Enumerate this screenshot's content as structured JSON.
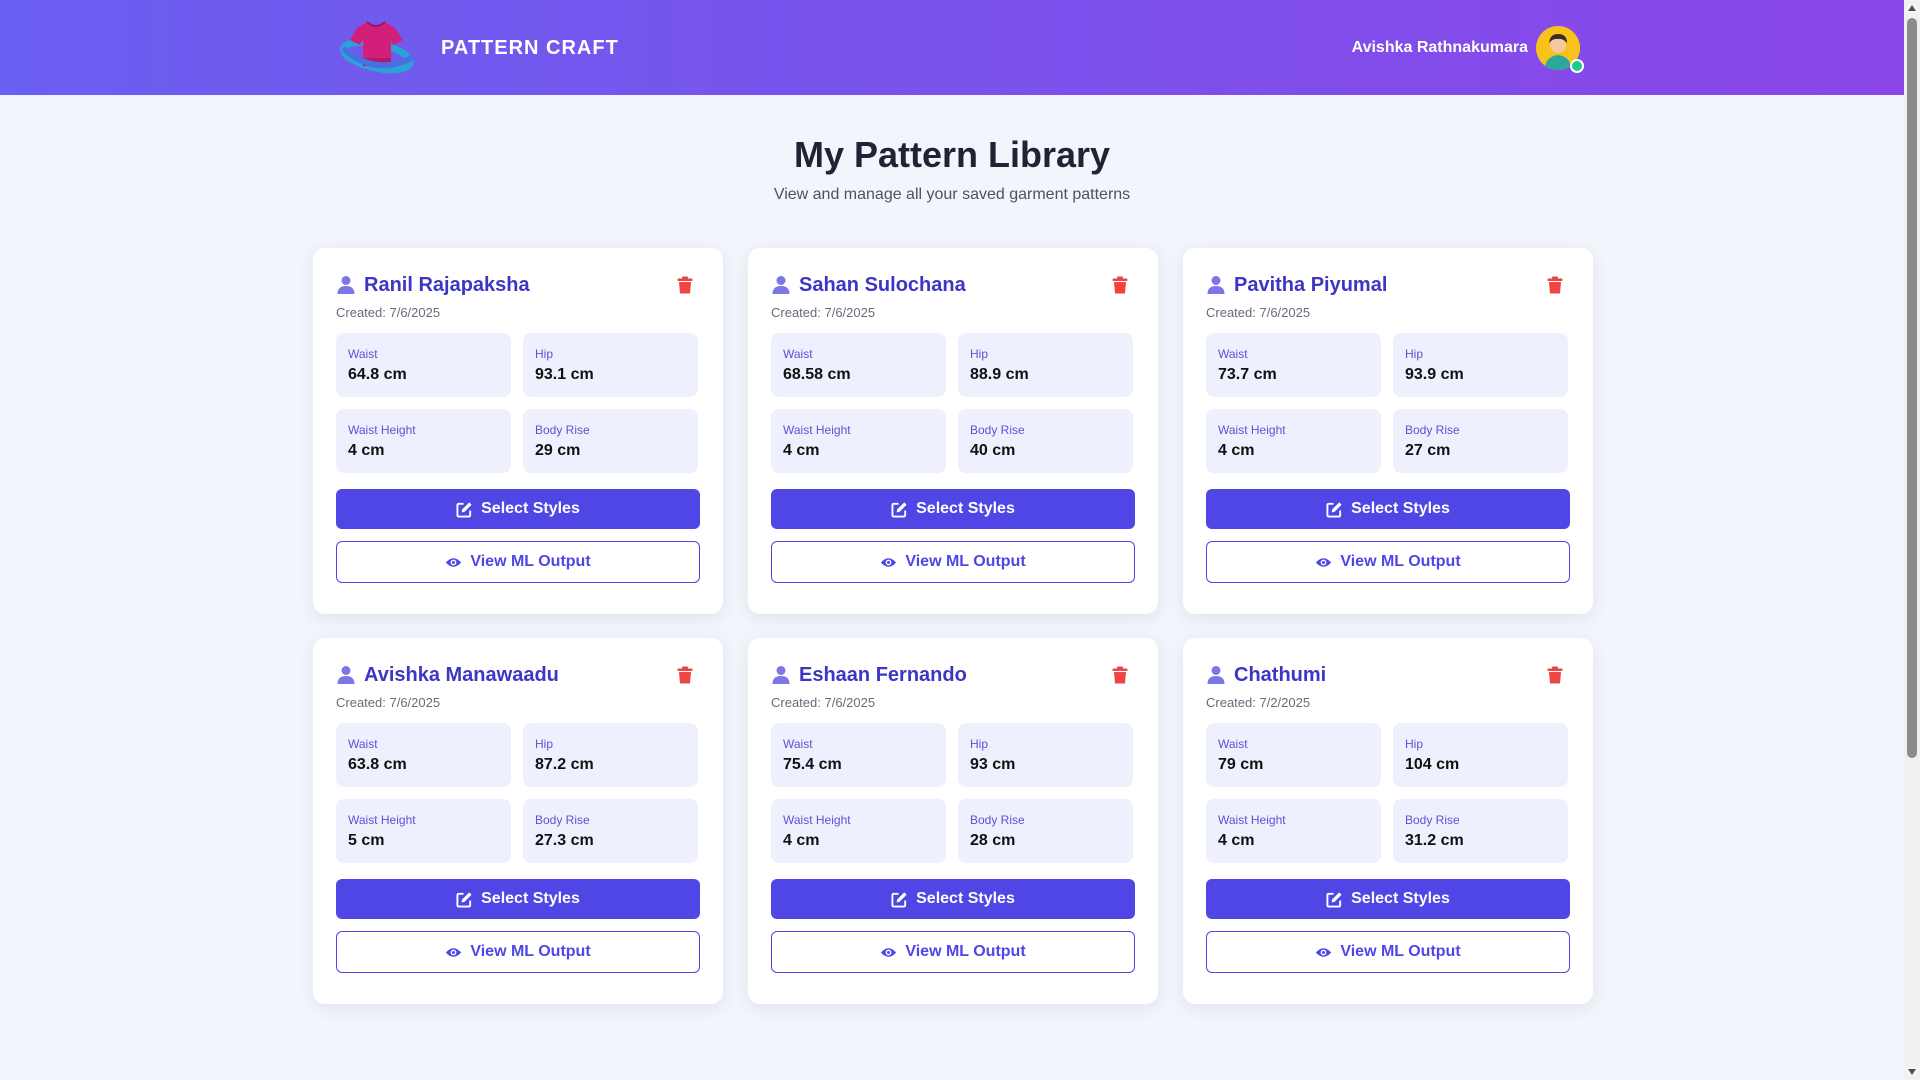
{
  "header": {
    "brand_name": "PATTERN CRAFT",
    "user_name": "Avishka Rathnakumara",
    "logo_icon": "tshirt-logo-icon",
    "avatar_icon": "user-avatar-icon",
    "status": "online"
  },
  "page": {
    "title": "My Pattern Library",
    "subtitle": "View and manage all your saved garment patterns"
  },
  "labels": {
    "waist": "Waist",
    "hip": "Hip",
    "waist_height": "Waist Height",
    "body_rise": "Body Rise",
    "select_styles": "Select Styles",
    "view_ml_output": "View ML Output"
  },
  "patterns": [
    {
      "name": "Ranil Rajapaksha",
      "created": "Created: 7/6/2025",
      "waist": "64.8 cm",
      "hip": "93.1 cm",
      "waist_height": "4 cm",
      "body_rise": "29 cm"
    },
    {
      "name": "Sahan Sulochana",
      "created": "Created: 7/6/2025",
      "waist": "68.58 cm",
      "hip": "88.9 cm",
      "waist_height": "4 cm",
      "body_rise": "40 cm"
    },
    {
      "name": "Pavitha Piyumal",
      "created": "Created: 7/6/2025",
      "waist": "73.7 cm",
      "hip": "93.9 cm",
      "waist_height": "4 cm",
      "body_rise": "27 cm"
    },
    {
      "name": "Avishka Manawaadu",
      "created": "Created: 7/6/2025",
      "waist": "63.8 cm",
      "hip": "87.2 cm",
      "waist_height": "5 cm",
      "body_rise": "27.3 cm"
    },
    {
      "name": "Eshaan Fernando",
      "created": "Created: 7/6/2025",
      "waist": "75.4 cm",
      "hip": "93 cm",
      "waist_height": "4 cm",
      "body_rise": "28 cm"
    },
    {
      "name": "Chathumi",
      "created": "Created: 7/2/2025",
      "waist": "79 cm",
      "hip": "104 cm",
      "waist_height": "4 cm",
      "body_rise": "31.2 cm"
    }
  ],
  "icons": {
    "person": "user-icon",
    "delete": "trash-icon",
    "edit": "edit-icon",
    "view": "eye-icon"
  },
  "colors": {
    "header_gradient_start": "#6a5ff0",
    "header_gradient_end": "#8a45e8",
    "primary": "#4f46e5",
    "name_text": "#3d36c4",
    "delete": "#ef4444",
    "measure_bg": "#eef1fd",
    "page_bg": "#f3f5fc"
  }
}
